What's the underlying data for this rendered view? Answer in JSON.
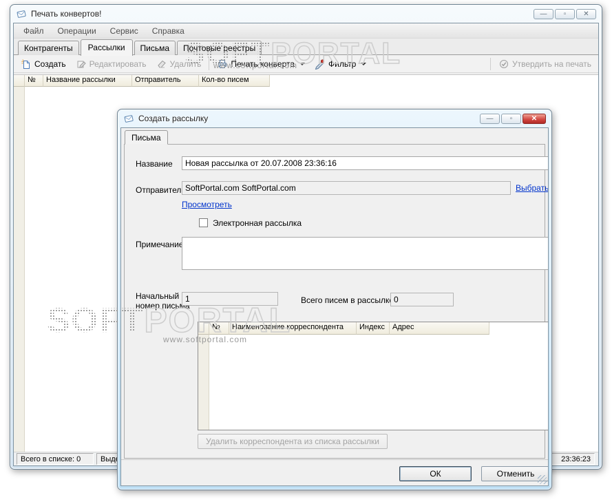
{
  "colors": {
    "link": "#0033cc",
    "close_red": "#d0453f",
    "header_beige": "#f0ecdd",
    "disabled_text": "#a2a2a2"
  },
  "main_window": {
    "title": "Печать конвертов!",
    "window_buttons": {
      "minimize": "—",
      "maximize": "▫",
      "close": "✕"
    },
    "menu": [
      "Файл",
      "Операции",
      "Сервис",
      "Справка"
    ],
    "tabs": [
      {
        "label": "Контрагенты",
        "active": false
      },
      {
        "label": "Рассылки",
        "active": true
      },
      {
        "label": "Письма",
        "active": false
      },
      {
        "label": "Почтовые реестры",
        "active": false
      }
    ],
    "toolbar": {
      "create": "Создать",
      "edit": "Редактировать",
      "delete": "Удалить",
      "print": "Печать конверта",
      "filter": "Фильтр",
      "approve": "Утвердить на печать"
    },
    "list": {
      "columns": [
        "№",
        "Название рассылки",
        "Отправитель",
        "Кол-во писем"
      ]
    },
    "statusbar": {
      "total": "Всего в списке: 0",
      "selected": "Выделено",
      "time": "23:36:23"
    }
  },
  "dialog": {
    "title": "Создать рассылку",
    "window_buttons": {
      "minimize": "—",
      "maximize": "▫",
      "close": "✕"
    },
    "tab": "Письма",
    "fields": {
      "name_label": "Название",
      "name_value": "Новая рассылка от 20.07.2008 23:36:16",
      "sender_label": "Отправитель",
      "sender_value": "SoftPortal.com SoftPortal.com",
      "choose_link": "Выбрать",
      "view_link": "Просмотреть",
      "email_checkbox_label": "Электронная рассылка",
      "note_label": "Примечание",
      "start_label_line1": "Начальный",
      "start_label_line2": "номер письма",
      "start_value": "1",
      "total_label": "Всего писем в рассылке",
      "total_value": "0"
    },
    "table": {
      "columns": [
        "№",
        "Наименование корреспондента",
        "Индекс",
        "Адрес"
      ]
    },
    "remove_button": "Удалить корреспондента из списка рассылки",
    "ok": "ОК",
    "cancel": "Отменить"
  },
  "watermark": {
    "soft": "SOFT",
    "portal": "PORTAL",
    "url": "www.softportal.com"
  }
}
